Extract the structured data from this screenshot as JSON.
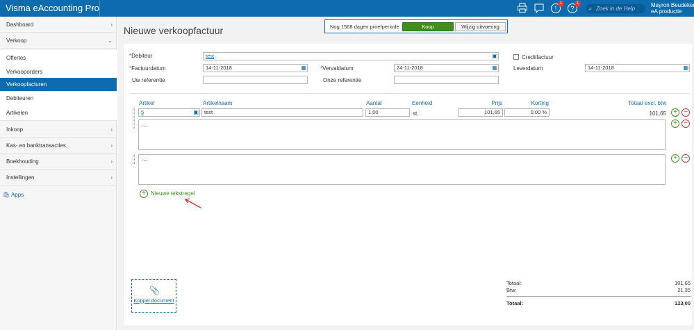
{
  "app": {
    "title": "Visma eAccounting Pro"
  },
  "header": {
    "help_placeholder": "Zoek in de Help",
    "user_name": "Mayron Beudeker",
    "company": "eA productie",
    "badge1": "1",
    "badge2": "1"
  },
  "sidebar": {
    "items": [
      {
        "label": "Dashboard"
      },
      {
        "label": "Verkoop"
      },
      {
        "label": "Offertes"
      },
      {
        "label": "Verkooporders"
      },
      {
        "label": "Verkoopfacturen"
      },
      {
        "label": "Debiteuren"
      },
      {
        "label": "Artikelen"
      },
      {
        "label": "Inkoop"
      },
      {
        "label": "Kas- en banktransacties"
      },
      {
        "label": "Boekhouding"
      },
      {
        "label": "Instellingen"
      }
    ],
    "apps_label": "Apps"
  },
  "page": {
    "title": "Nieuwe verkoopfactuur"
  },
  "trial": {
    "text": "Nog 1568 dagen proefperiode",
    "buy": "Koop",
    "change": "Wijzig uitvoering"
  },
  "form": {
    "debiteur_label": "Debiteur",
    "debiteur_value": "test",
    "creditfactuur_label": "Creditfactuur",
    "factuurdatum_label": "Factuurdatum",
    "factuurdatum": "14-11-2018",
    "vervaldatum_label": "Vervaldatum",
    "vervaldatum": "24-11-2018",
    "leverdatum_label": "Leverdatum",
    "leverdatum": "14-11-2018",
    "uw_ref_label": "Uw referentie",
    "onze_ref_label": "Onze referentie"
  },
  "table": {
    "headers": {
      "artikel": "Artikel",
      "artikelnaam": "Artikelnaam",
      "aantal": "Aantal",
      "eenheid": "Eenheid",
      "prijs": "Prijs",
      "korting": "Korting",
      "totaal": "Totaal excl. btw"
    },
    "row": {
      "artikel": "5",
      "artikelnaam": "test",
      "aantal": "1,00",
      "eenheid": "st.",
      "prijs": "101,65",
      "korting": "0,00 %",
      "totaal": "101,65"
    },
    "text1": "....",
    "text2": "...."
  },
  "new_text_line": "Nieuwe tekstregel",
  "attach": "Koppel document",
  "totals": {
    "totaal_label": "Totaal:",
    "totaal": "101,65",
    "btw_label": "Btw:",
    "btw": "21,35",
    "grand_label": "Totaal:",
    "grand": "123,00"
  }
}
